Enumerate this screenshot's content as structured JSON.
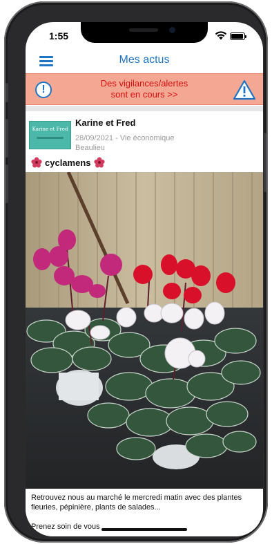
{
  "status_bar": {
    "time": "1:55"
  },
  "navbar": {
    "title": "Mes actus"
  },
  "alert": {
    "text_line1": "Des vigilances/alertes",
    "text_line2": "sont en cours >>"
  },
  "post": {
    "thumbnail_text": "Karine et Fred",
    "author": "Karine et Fred",
    "date_category": "28/09/2021 - Vie économique",
    "location": "Beaulieu",
    "title": "cyclamens",
    "caption": "Retrouvez nous au marché le mercredi matin avec des plantes fleuries, pépinière, plants de salades...",
    "caption_more": "Prenez soin de vous"
  },
  "colors": {
    "accent": "#1d74c5",
    "alert_bg": "#f4a793",
    "alert_text": "#d30f0f"
  }
}
